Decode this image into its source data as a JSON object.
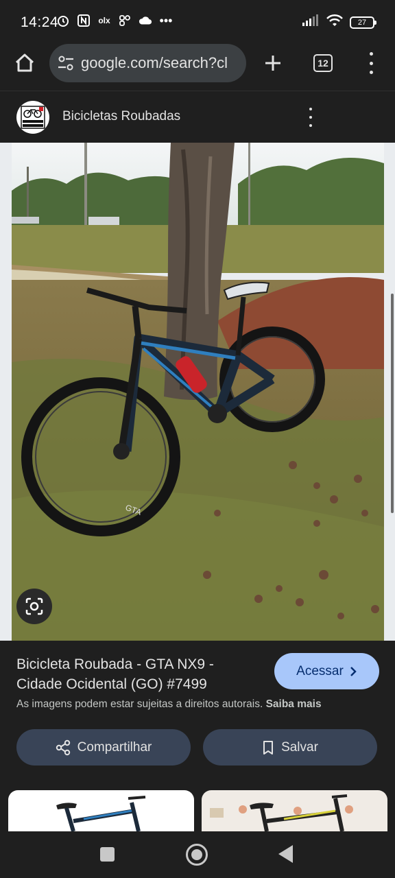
{
  "status_bar": {
    "time": "14:24",
    "battery": "27",
    "left_icons": [
      "alarm-icon",
      "nfc-icon",
      "olx-icon",
      "app-icon",
      "cloud-icon",
      "more-dots-icon"
    ],
    "right_icons": [
      "signal-icon",
      "wifi-icon",
      "battery-icon"
    ]
  },
  "browser": {
    "url": "google.com/search?cl",
    "tab_count": "12"
  },
  "site": {
    "name": "Bicicletas Roubadas",
    "logo_text": "BICICLETAS ROUBADAS"
  },
  "result": {
    "title": "Bicicleta Roubada - GTA NX9 - Cidade Ocidental (GO) #7499",
    "visit_label": "Acessar",
    "copyright_text": "As imagens podem estar sujeitas a direitos autorais.",
    "learn_more": "Saiba mais",
    "share_label": "Compartilhar",
    "save_label": "Salvar"
  },
  "image": {
    "bike_brand": "GTA"
  },
  "colors": {
    "background": "#1f1f1f",
    "accent_button": "#a8c7fa",
    "action_button": "#394457",
    "url_bar": "#3c4043"
  }
}
